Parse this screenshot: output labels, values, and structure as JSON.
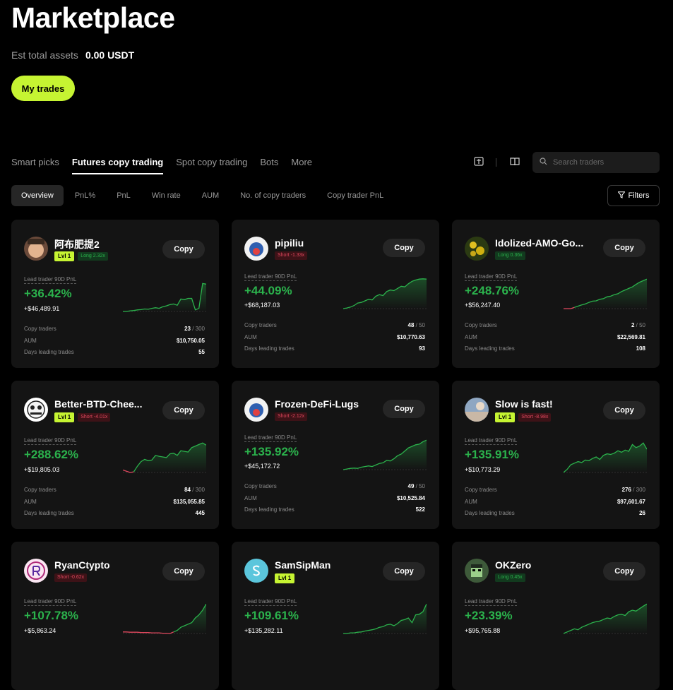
{
  "header": {
    "title": "Marketplace",
    "assets_label": "Est total assets",
    "assets_value": "0.00 USDT",
    "my_trades_label": "My trades"
  },
  "main_tabs": [
    {
      "label": "Smart picks",
      "active": false
    },
    {
      "label": "Futures copy trading",
      "active": true
    },
    {
      "label": "Spot copy trading",
      "active": false
    },
    {
      "label": "Bots",
      "active": false
    },
    {
      "label": "More",
      "active": false
    }
  ],
  "toolbar": {
    "icons": [
      "calculator-icon",
      "book-icon"
    ],
    "search_placeholder": "Search traders"
  },
  "sub_tabs": [
    {
      "label": "Overview",
      "active": true
    },
    {
      "label": "PnL%",
      "active": false
    },
    {
      "label": "PnL",
      "active": false
    },
    {
      "label": "Win rate",
      "active": false
    },
    {
      "label": "AUM",
      "active": false
    },
    {
      "label": "No. of copy traders",
      "active": false
    },
    {
      "label": "Copy trader PnL",
      "active": false
    }
  ],
  "filters_label": "Filters",
  "labels": {
    "copy": "Copy",
    "pnl_label": "Lead trader 90D PnL",
    "copy_traders": "Copy traders",
    "aum": "AUM",
    "days_leading": "Days leading trades"
  },
  "colors": {
    "accent": "#c6f432",
    "positive": "#2bb24c",
    "negative": "#e0485e",
    "card_bg": "#141414"
  },
  "traders": [
    {
      "name": "阿布肥提2",
      "lvl": "Lvl 1",
      "position": "Long 2.32x",
      "side": "long",
      "pnl_pct": "+36.42%",
      "pnl_abs": "+$46,489.91",
      "copy_traders": "23",
      "copy_cap": "300",
      "aum": "$10,750.05",
      "days": "55",
      "avatar_icon": "person-avatar-icon",
      "spark": [
        0,
        0,
        0.02,
        0.03,
        0.05,
        0.06,
        0.08,
        0.07,
        0.1,
        0.12,
        0.1,
        0.15,
        0.18,
        0.22,
        0.24,
        0.2,
        0.4,
        0.38,
        0.42,
        0.42,
        0.05,
        0.1,
        0.9,
        0.88
      ],
      "neg_points": 0
    },
    {
      "name": "pipiliu",
      "lvl": "",
      "position": "Short -1.33x",
      "side": "short",
      "pnl_pct": "+44.09%",
      "pnl_abs": "+$68,187.03",
      "copy_traders": "48",
      "copy_cap": "50",
      "aum": "$10,770.63",
      "days": "93",
      "avatar_icon": "cartoon-avatar-icon",
      "spark": [
        0,
        0.02,
        0.05,
        0.1,
        0.18,
        0.2,
        0.25,
        0.3,
        0.28,
        0.4,
        0.45,
        0.42,
        0.55,
        0.6,
        0.58,
        0.65,
        0.72,
        0.7,
        0.8,
        0.88,
        0.92,
        0.95,
        0.96,
        0.95
      ],
      "neg_points": 0
    },
    {
      "name": "Idolized-AMO-Go...",
      "lvl": "",
      "position": "Long 0.36x",
      "side": "long",
      "pnl_pct": "+248.76%",
      "pnl_abs": "+$56,247.40",
      "copy_traders": "2",
      "copy_cap": "50",
      "aum": "$22,569.81",
      "days": "108",
      "avatar_icon": "flower-avatar-icon",
      "spark": [
        0,
        0,
        0,
        0.04,
        0.08,
        0.12,
        0.15,
        0.2,
        0.24,
        0.25,
        0.3,
        0.32,
        0.38,
        0.4,
        0.45,
        0.48,
        0.55,
        0.6,
        0.65,
        0.7,
        0.78,
        0.85,
        0.9,
        0.95
      ],
      "neg_points": 3
    },
    {
      "name": "Better-BTD-Chee...",
      "lvl": "Lvl 1",
      "position": "Short -4.01x",
      "side": "short",
      "pnl_pct": "+288.62%",
      "pnl_abs": "+$19,805.03",
      "copy_traders": "84",
      "copy_cap": "300",
      "aum": "$135,055.85",
      "days": "445",
      "avatar_icon": "panda-avatar-icon",
      "spark": [
        0.08,
        0.04,
        0,
        0.02,
        0.2,
        0.35,
        0.42,
        0.38,
        0.4,
        0.55,
        0.52,
        0.5,
        0.48,
        0.6,
        0.62,
        0.55,
        0.7,
        0.68,
        0.66,
        0.8,
        0.85,
        0.9,
        0.95,
        0.88
      ],
      "neg_points": 3
    },
    {
      "name": "Frozen-DeFi-Lugs",
      "lvl": "",
      "position": "Short -2.12x",
      "side": "short",
      "pnl_pct": "+135.92%",
      "pnl_abs": "+$45,172.72",
      "copy_traders": "49",
      "copy_cap": "50",
      "aum": "$10,525.84",
      "days": "522",
      "avatar_icon": "cartoon-avatar-icon",
      "spark": [
        0,
        0.02,
        0.04,
        0.05,
        0.04,
        0.08,
        0.1,
        0.12,
        0.1,
        0.15,
        0.2,
        0.22,
        0.3,
        0.28,
        0.35,
        0.45,
        0.5,
        0.6,
        0.7,
        0.75,
        0.8,
        0.82,
        0.9,
        0.95
      ],
      "neg_points": 0
    },
    {
      "name": "Slow is fast!",
      "lvl": "Lvl 1",
      "position": "Short -8.98x",
      "side": "short",
      "pnl_pct": "+135.91%",
      "pnl_abs": "+$10,773.29",
      "copy_traders": "276",
      "copy_cap": "300",
      "aum": "$97,601.67",
      "days": "26",
      "avatar_icon": "sky-avatar-icon",
      "spark": [
        0,
        0.1,
        0.25,
        0.3,
        0.35,
        0.32,
        0.4,
        0.38,
        0.45,
        0.5,
        0.42,
        0.55,
        0.6,
        0.58,
        0.62,
        0.7,
        0.65,
        0.72,
        0.68,
        0.9,
        0.8,
        0.85,
        0.95,
        0.75
      ],
      "neg_points": 0
    },
    {
      "name": "RyanCtypto",
      "lvl": "",
      "position": "Short -0.62x",
      "side": "short",
      "pnl_pct": "+107.78%",
      "pnl_abs": "+$5,863.24",
      "copy_traders": "",
      "copy_cap": "",
      "aum": "",
      "days": "",
      "avatar_icon": "letter-r-avatar-icon",
      "spark": [
        0.05,
        0.05,
        0.04,
        0.04,
        0.04,
        0.03,
        0.03,
        0.03,
        0.02,
        0.02,
        0.02,
        0.01,
        0.01,
        0,
        0.05,
        0.1,
        0.2,
        0.25,
        0.3,
        0.35,
        0.5,
        0.6,
        0.75,
        0.95
      ],
      "neg_points": 14
    },
    {
      "name": "SamSipMan",
      "lvl": "Lvl 1",
      "position": "",
      "side": "",
      "pnl_pct": "+109.61%",
      "pnl_abs": "+$135,282.11",
      "copy_traders": "",
      "copy_cap": "",
      "aum": "",
      "days": "",
      "avatar_icon": "letter-s-avatar-icon",
      "spark": [
        0,
        0,
        0.02,
        0.02,
        0.04,
        0.05,
        0.08,
        0.1,
        0.12,
        0.15,
        0.2,
        0.22,
        0.28,
        0.3,
        0.25,
        0.32,
        0.42,
        0.45,
        0.5,
        0.35,
        0.6,
        0.62,
        0.7,
        0.95
      ],
      "neg_points": 0
    },
    {
      "name": "OKZero",
      "lvl": "",
      "position": "Long 0.45x",
      "side": "long",
      "pnl_pct": "+23.39%",
      "pnl_abs": "+$95,765.88",
      "copy_traders": "",
      "copy_cap": "",
      "aum": "",
      "days": "",
      "avatar_icon": "pixel-avatar-icon",
      "spark": [
        0,
        0.05,
        0.1,
        0.15,
        0.12,
        0.2,
        0.25,
        0.3,
        0.35,
        0.38,
        0.4,
        0.45,
        0.5,
        0.48,
        0.55,
        0.6,
        0.62,
        0.58,
        0.7,
        0.75,
        0.72,
        0.8,
        0.88,
        0.95
      ],
      "neg_points": 0
    }
  ]
}
